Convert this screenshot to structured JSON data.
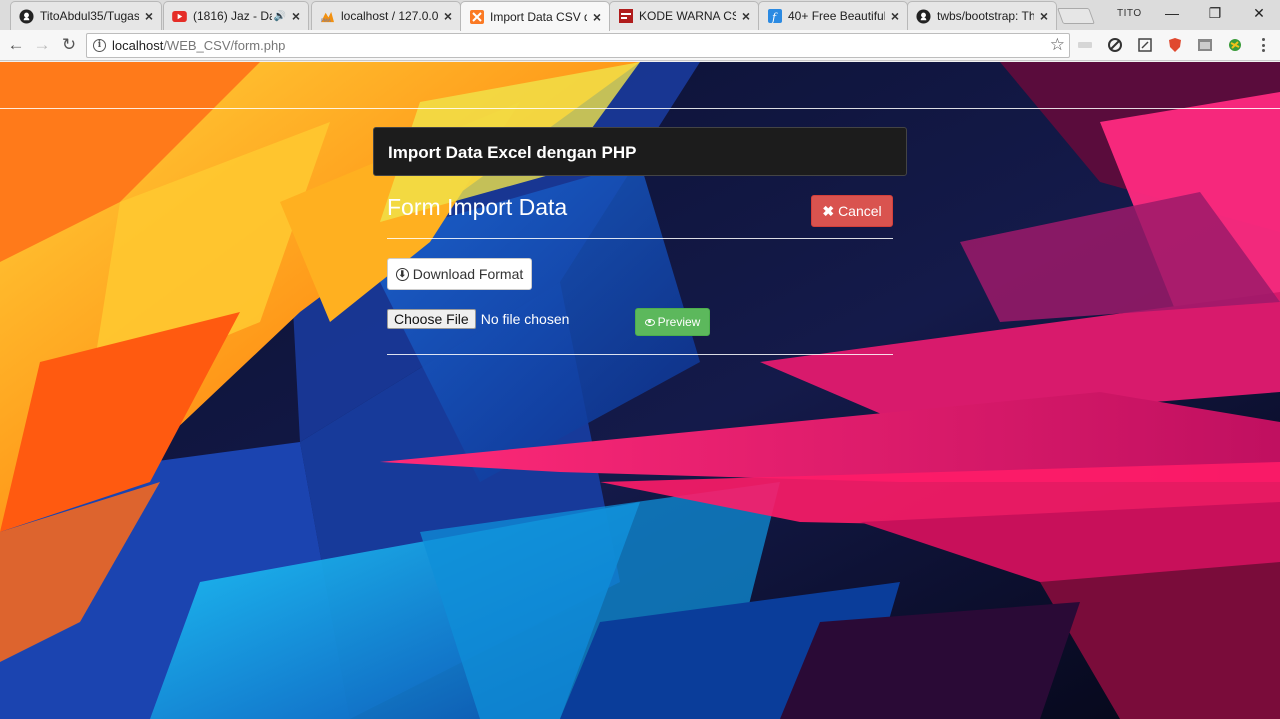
{
  "browser": {
    "tabs": [
      {
        "title": "TitoAbdul35/Tugas",
        "icon": "github-icon",
        "active": false,
        "audio": false
      },
      {
        "title": "(1816) Jaz - Dar",
        "icon": "youtube-icon",
        "active": false,
        "audio": true
      },
      {
        "title": "localhost / 127.0.0",
        "icon": "phpmyadmin-icon",
        "active": false,
        "audio": false
      },
      {
        "title": "Import Data CSV d",
        "icon": "xampp-icon",
        "active": true,
        "audio": false
      },
      {
        "title": "KODE WARNA CSS",
        "icon": "site-icon",
        "active": false,
        "audio": false
      },
      {
        "title": "40+ Free Beautiful",
        "icon": "f-icon",
        "active": false,
        "audio": false
      },
      {
        "title": "twbs/bootstrap: Th",
        "icon": "github-icon",
        "active": false,
        "audio": false
      }
    ],
    "profile_name": "TITO",
    "address": {
      "host": "localhost",
      "path": "/WEB_CSV/form.php"
    },
    "window_controls": {
      "minimize": "—",
      "restore": "❐",
      "close": "✕"
    },
    "nav": {
      "back": "←",
      "forward": "→",
      "reload": "↻",
      "bookmark": "☆"
    }
  },
  "page": {
    "panel_title": "Import Data Excel dengan PHP",
    "form_title": "Form Import Data",
    "cancel_label": "Cancel",
    "cancel_icon": "✖",
    "download_label": "Download Format",
    "download_icon": "⬇",
    "file_button_label": "Choose File",
    "file_status": "No file chosen",
    "preview_label": "Preview",
    "colors": {
      "cancel": "#d9534f",
      "preview": "#5cb85c",
      "panel_heading": "#1c1c1c"
    }
  }
}
